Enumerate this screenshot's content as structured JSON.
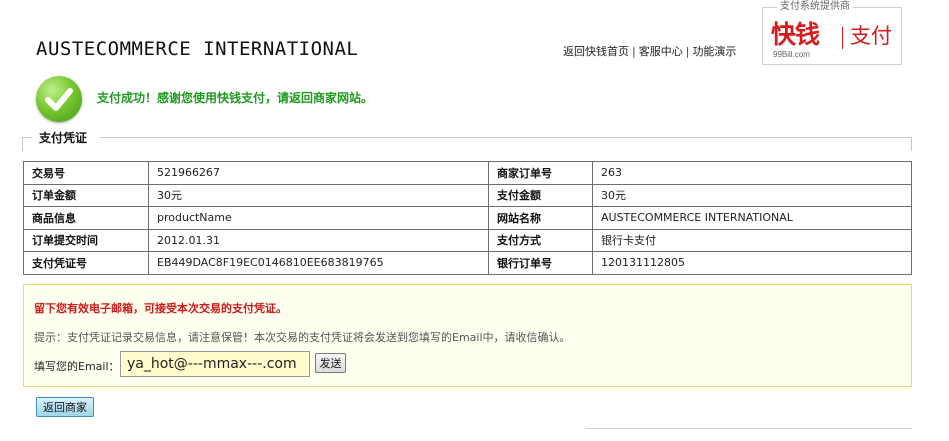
{
  "header": {
    "merchant_name": "AUSTECOMMERCE INTERNATIONAL",
    "links": [
      "返回快钱首页",
      "客服中心",
      "功能演示"
    ],
    "link_separator": "|",
    "brand": {
      "caption": "支付系统提供商",
      "logo_text": "快钱",
      "domain": "99Bill.com",
      "pay_label": "支付"
    }
  },
  "status": {
    "icon": "check-icon",
    "icon_color": "#5fb41c",
    "message": "支付成功！感谢您使用快钱支付，请返回商家网站。",
    "message_color": "#219a21"
  },
  "receipt": {
    "legend": "支付凭证",
    "rows": [
      {
        "k1": "交易号",
        "v1": "521966267",
        "k2": "商家订单号",
        "v2": "263"
      },
      {
        "k1": "订单金额",
        "v1": "30元",
        "k2": "支付金额",
        "v2": "30元"
      },
      {
        "k1": "商品信息",
        "v1": "productName",
        "k2": "网站名称",
        "v2": "AUSTECOMMERCE INTERNATIONAL"
      },
      {
        "k1": "订单提交时间",
        "v1": "2012.01.31",
        "k2": "支付方式",
        "v2": "银行卡支付"
      },
      {
        "k1": "支付凭证号",
        "v1": "EB449DAC8F19EC0146810EE683819765",
        "k2": "银行订单号",
        "v2": "120131112805"
      }
    ]
  },
  "email_notice": {
    "title": "留下您有效电子邮箱，可接受本次交易的支付凭证。",
    "title_color": "#cc1a1a",
    "tip": "提示：支付凭证记录交易信息，请注意保管！本次交易的支付凭证将会发送到您填写的Email中，请收信确认。",
    "email_label": "填写您的Email：",
    "email_value": "ya_hot@---mmax---.com",
    "send_label": "发送"
  },
  "actions": {
    "return_label": "返回商家"
  }
}
